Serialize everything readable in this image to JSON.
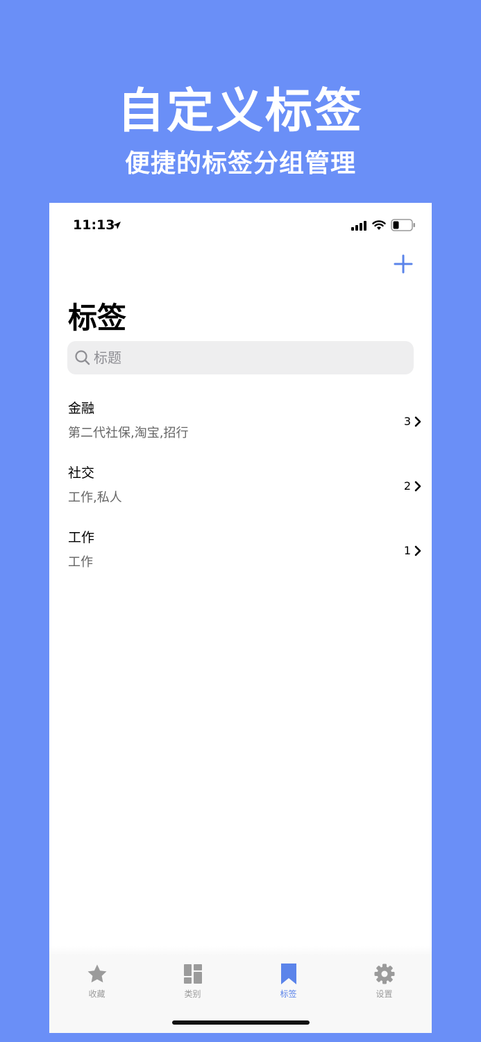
{
  "promo": {
    "title": "自定义标签",
    "subtitle": "便捷的标签分组管理"
  },
  "status_bar": {
    "time": "11:13"
  },
  "header": {
    "title": "标签",
    "add_icon": "plus-icon"
  },
  "search": {
    "placeholder": "标题",
    "value": ""
  },
  "tags": [
    {
      "name": "金融",
      "items": "第二代社保,淘宝,招行",
      "count": "3"
    },
    {
      "name": "社交",
      "items": "工作,私人",
      "count": "2"
    },
    {
      "name": "工作",
      "items": "工作",
      "count": "1"
    }
  ],
  "tab_bar": {
    "tabs": [
      {
        "label": "收藏",
        "icon": "star-icon",
        "active": false
      },
      {
        "label": "类别",
        "icon": "category-icon",
        "active": false
      },
      {
        "label": "标签",
        "icon": "bookmark-icon",
        "active": true
      },
      {
        "label": "设置",
        "icon": "gear-icon",
        "active": false
      }
    ]
  },
  "colors": {
    "background": "#6a8ff7",
    "accent": "#5b84ea",
    "inactive_tab": "#9b9b9b"
  }
}
